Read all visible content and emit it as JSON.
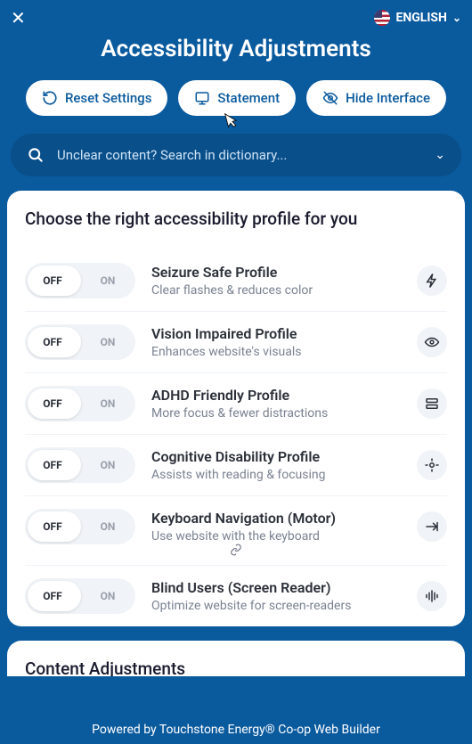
{
  "header": {
    "language_label": "ENGLISH",
    "title": "Accessibility Adjustments"
  },
  "buttons": {
    "reset": "Reset Settings",
    "statement": "Statement",
    "hide": "Hide Interface"
  },
  "search": {
    "placeholder": "Unclear content? Search in dictionary..."
  },
  "profiles_heading": "Choose the right accessibility profile for you",
  "toggle": {
    "off": "OFF",
    "on": "ON"
  },
  "profiles": [
    {
      "title": "Seizure Safe Profile",
      "sub": "Clear flashes & reduces color"
    },
    {
      "title": "Vision Impaired Profile",
      "sub": "Enhances website's visuals"
    },
    {
      "title": "ADHD Friendly Profile",
      "sub": "More focus & fewer distractions"
    },
    {
      "title": "Cognitive Disability Profile",
      "sub": "Assists with reading & focusing"
    },
    {
      "title": "Keyboard Navigation (Motor)",
      "sub": "Use website with the keyboard"
    },
    {
      "title": "Blind Users (Screen Reader)",
      "sub": "Optimize website for screen-readers"
    }
  ],
  "content_adjustments_heading": "Content Adjustments",
  "footer": "Powered by Touchstone Energy® Co-op Web Builder"
}
